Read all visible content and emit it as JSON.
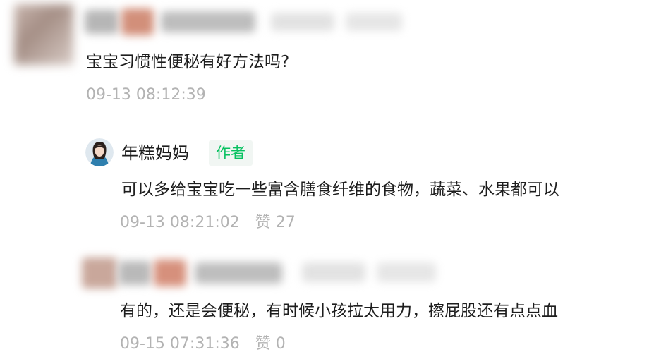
{
  "comments": [
    {
      "text": "宝宝习惯性便秘有好方法吗?",
      "time": "09-13 08:12:39"
    }
  ],
  "reply": {
    "author": "年糕妈妈",
    "badge": "作者",
    "text": "可以多给宝宝吃一些富含膳食纤维的食物，蔬菜、水果都可以",
    "time": "09-13 08:21:02",
    "like_label": "赞",
    "like_count": "27"
  },
  "reply2": {
    "text": "有的，还是会便秘，有时候小孩拉太用力，擦屁股还有点点血",
    "time": "09-15 07:31:36",
    "like_label": "赞",
    "like_count": "0"
  },
  "colors": {
    "badge_text": "#07c160",
    "badge_bg": "#f1f6f3",
    "meta_text": "#b3b3b3"
  }
}
